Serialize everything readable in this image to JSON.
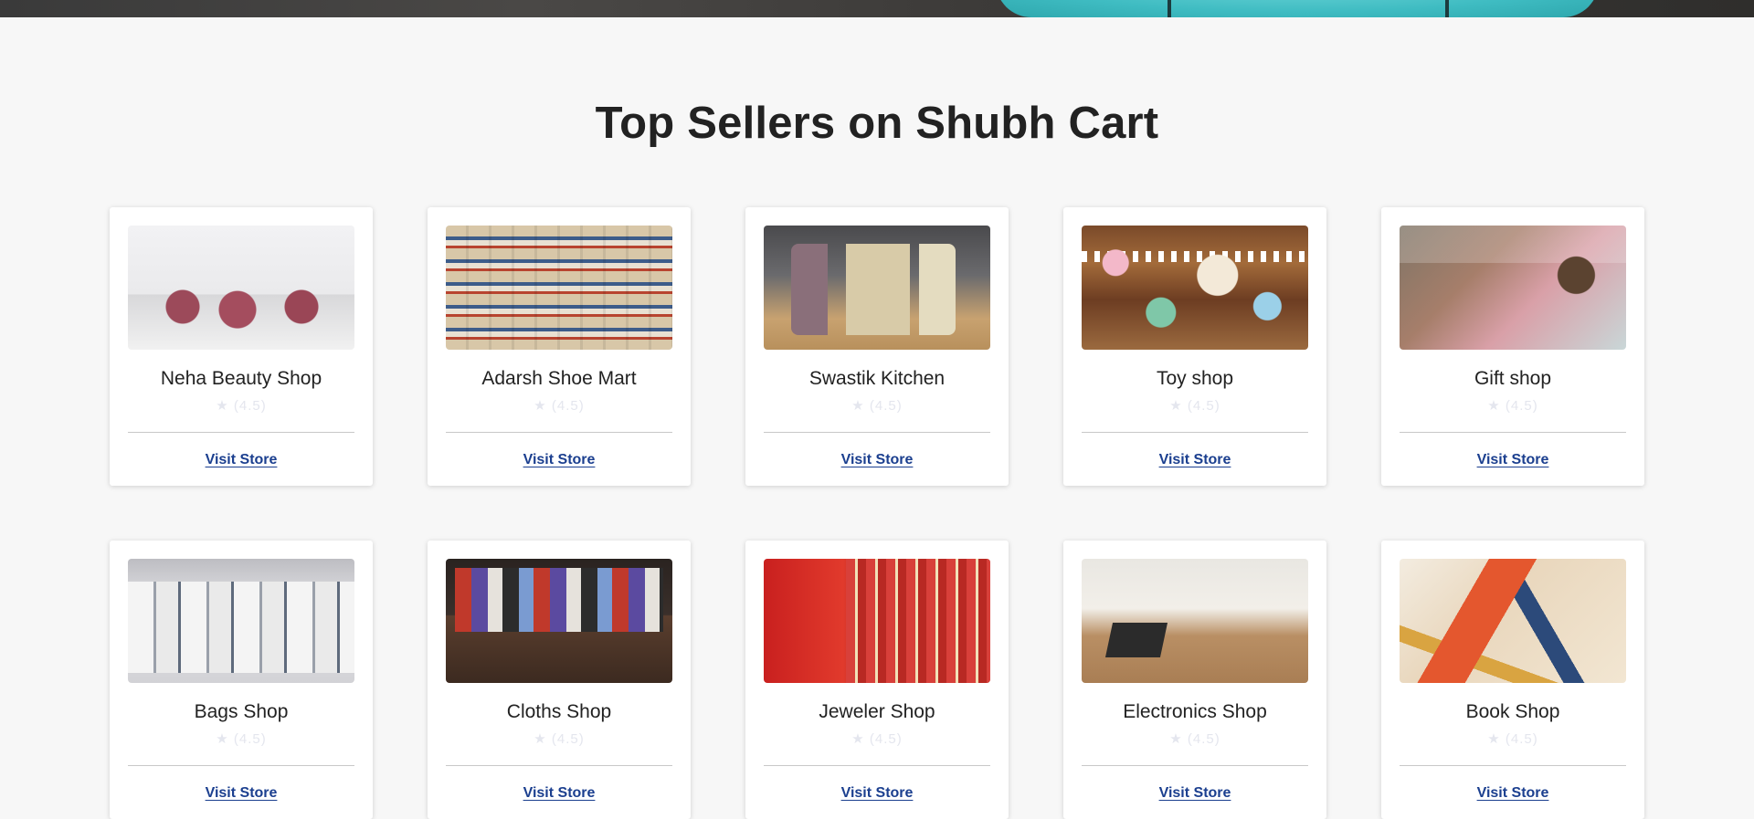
{
  "section_title": "Top Sellers on Shubh Cart",
  "rating_star": "★",
  "stores": [
    {
      "name": "Neha Beauty Shop",
      "rating": "(4.5)",
      "link": "Visit Store",
      "image": "beauty-salon-photo"
    },
    {
      "name": "Adarsh Shoe Mart",
      "rating": "(4.5)",
      "link": "Visit Store",
      "image": "shoe-wall-photo"
    },
    {
      "name": "Swastik Kitchen",
      "rating": "(4.5)",
      "link": "Visit Store",
      "image": "kitchen-appliances-photo"
    },
    {
      "name": "Toy shop",
      "rating": "(4.5)",
      "link": "Visit Store",
      "image": "toy-shelf-photo"
    },
    {
      "name": "Gift shop",
      "rating": "(4.5)",
      "link": "Visit Store",
      "image": "gift-boxes-photo"
    },
    {
      "name": "Bags Shop",
      "rating": "(4.5)",
      "link": "Visit Store",
      "image": "tote-bags-photo"
    },
    {
      "name": "Cloths Shop",
      "rating": "(4.5)",
      "link": "Visit Store",
      "image": "clothing-racks-photo"
    },
    {
      "name": "Jeweler Shop",
      "rating": "(4.5)",
      "link": "Visit Store",
      "image": "jewelry-display-photo"
    },
    {
      "name": "Electronics Shop",
      "rating": "(4.5)",
      "link": "Visit Store",
      "image": "electronics-counter-photo"
    },
    {
      "name": "Book Shop",
      "rating": "(4.5)",
      "link": "Visit Store",
      "image": "books-table-photo"
    }
  ],
  "colors": {
    "background": "#f7f7f7",
    "link": "#1b3f8f",
    "star": "#e4e6ee",
    "hero_accent": "#3fbcc2"
  }
}
